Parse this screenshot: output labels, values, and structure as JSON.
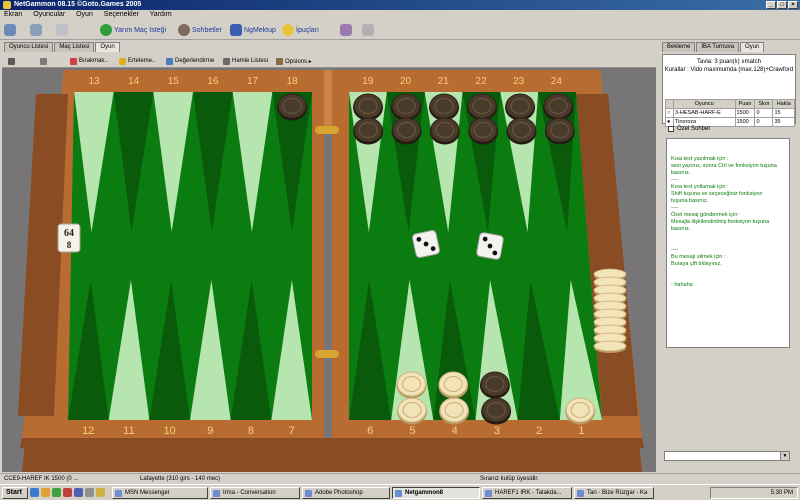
{
  "window": {
    "title": "NetGammon 08.15 ©Goto.Games 2005"
  },
  "menu": [
    "Ekran",
    "Oyuncular",
    "Oyun",
    "Seçenekler",
    "Yardım"
  ],
  "toolbar": [
    {
      "label": "Yarım Maç İsteği",
      "icon": "handshake-icon",
      "color": "#2e9d3a"
    },
    {
      "label": "Sohbetler",
      "icon": "person-icon",
      "color": "#7a6a60"
    },
    {
      "label": "NgMektup",
      "icon": "envelope-icon",
      "color": "#3a5fb0"
    },
    {
      "label": "İpuçları",
      "icon": "lightbulb-icon",
      "color": "#e8c23a"
    }
  ],
  "left_tabs": [
    "Oyuncu Listesi",
    "Maç Listesi",
    "Oyun"
  ],
  "left_active_tab": "Oyun",
  "right_tabs": [
    "Bekleme",
    "İBA Turnuva",
    "Oyun"
  ],
  "right_active_tab": "Oyun",
  "game_toolbar": [
    {
      "label": "",
      "icon": "undo-icon",
      "color": "#5a5a5a"
    },
    {
      "label": "",
      "icon": "chat-icon",
      "color": "#7a7a7a"
    },
    {
      "label": "Bırakmak..",
      "icon": "flag-icon",
      "color": "#d04040"
    },
    {
      "label": "Erteleme..",
      "icon": "clock-icon",
      "color": "#e0b020"
    },
    {
      "label": "Değerlendirme",
      "icon": "star-icon",
      "color": "#4a7ac0"
    },
    {
      "label": "Hamle Listesi",
      "icon": "list-icon",
      "color": "#6a6a6a"
    },
    {
      "label": "Opsions ▸",
      "icon": "gear-icon",
      "color": "#8a6a40"
    }
  ],
  "board": {
    "top_labels": [
      "13",
      "14",
      "15",
      "16",
      "17",
      "18",
      "19",
      "20",
      "21",
      "22",
      "23",
      "24"
    ],
    "bottom_labels": [
      "12",
      "11",
      "10",
      "9",
      "8",
      "7",
      "6",
      "5",
      "4",
      "3",
      "2",
      "1"
    ],
    "doubling_cube": {
      "top": "64",
      "bottom": "8"
    },
    "dice": [
      3,
      3
    ],
    "colors": {
      "felt": "#0b7d10",
      "light_point": "#b6e5b0",
      "dark_point": "#0a5a0c",
      "frame": "#b86c32",
      "checker_white": "#f2e3b8",
      "checker_dark": "#4a3a2a"
    },
    "points": [
      {
        "point": 18,
        "dark": 1,
        "white": 0
      },
      {
        "point": 19,
        "dark": 2,
        "white": 0
      },
      {
        "point": 20,
        "dark": 2,
        "white": 0
      },
      {
        "point": 21,
        "dark": 2,
        "white": 0
      },
      {
        "point": 22,
        "dark": 2,
        "white": 0
      },
      {
        "point": 23,
        "dark": 2,
        "white": 0
      },
      {
        "point": 24,
        "dark": 2,
        "white": 0
      },
      {
        "point": 5,
        "dark": 0,
        "white": 2
      },
      {
        "point": 4,
        "dark": 0,
        "white": 2
      },
      {
        "point": 3,
        "dark": 2,
        "white": 0
      },
      {
        "point": 1,
        "dark": 0,
        "white": 1
      }
    ],
    "borne_off_white": 10
  },
  "match_info": {
    "line1": "Tavla: 3 puan(lı) ıımatch",
    "line2": "Kurallar : Vido maximumda (max.128)+Crawford",
    "columns": [
      "Oyuncu",
      "Puan",
      "Skor",
      "Hakla"
    ],
    "players": [
      {
        "name": "3-HESAB-HARF-E",
        "rating": "1500",
        "score": "0",
        "extra": "15"
      },
      {
        "name": "Tinoroza",
        "rating": "1500",
        "score": "0",
        "extra": "35"
      }
    ]
  },
  "private_chat_label": "Özel Sohbet",
  "chat_lines": [
    "",
    "",
    "Kısa text yazılmak için :",
    "sezi yazınız, sonra Ctrl ve fonksiyon tuşuna",
    "basınız.",
    "----",
    "Kısa text yollamak için :",
    "Shift tuşuna ve seçeceğiniz fonksiyon",
    "tuşuna basınız.",
    "----",
    "Özel mesaj göndermek için:",
    "Mesajla ilişkilendirilmiş fonksiyon tuşuna",
    "basınız.",
    "",
    "",
    "----",
    "Bu mesajı silmek için :",
    "Buraya çift tıklayınız.",
    "",
    "",
    "- hahaha"
  ],
  "status": {
    "left": "CCE9-HAREF IK 1500 (0 ...",
    "center": "Lafayette (310 girs - 140 mec)",
    "right": "Sıranız kulüp üyesidir."
  },
  "taskbar": {
    "start": "Start",
    "buttons": [
      "MSN Messenger",
      "Irma - Conversation",
      "Adobe Photoshop",
      "Netgammon8",
      "HAREF1 IRK - Tatakda...",
      "Tan - Bize Rüzgar - Ka"
    ],
    "active": 3,
    "clock": "5:30 PM"
  }
}
